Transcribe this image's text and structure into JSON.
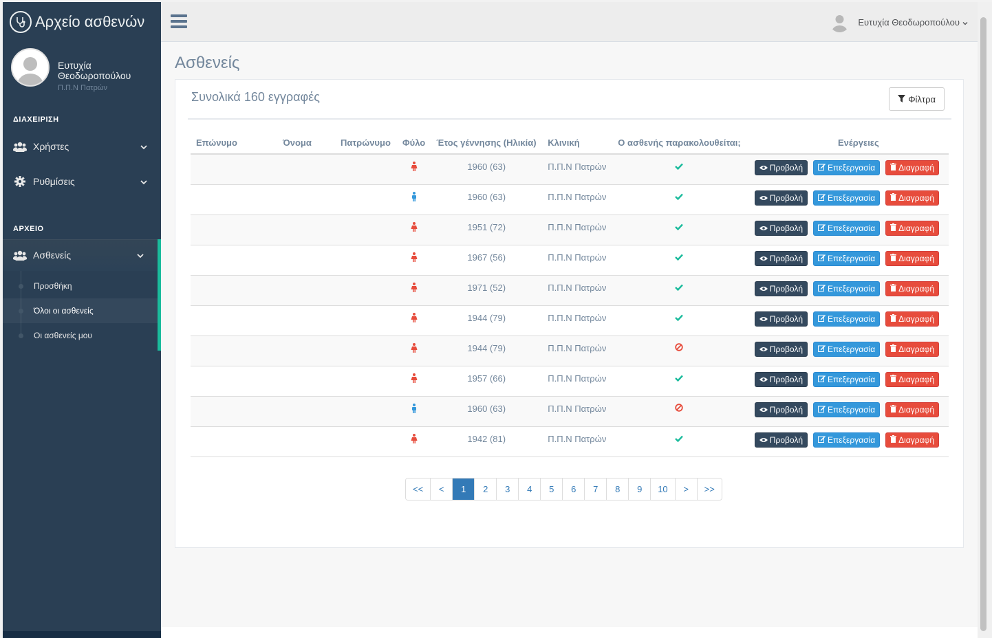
{
  "app": {
    "title": "Αρχείο ασθενών"
  },
  "profile": {
    "name": "Ευτυχία Θεοδωροπούλου",
    "clinic": "Π.Π.Ν Πατρών"
  },
  "sidebar": {
    "section_admin": "ΔΙΑΧΕΙΡΙΣΗ",
    "users": "Χρήστες",
    "settings": "Ρυθμίσεις",
    "section_archive": "ΑΡΧΕΙΟ",
    "patients": "Ασθενείς",
    "submenu": [
      {
        "label": "Προσθήκη"
      },
      {
        "label": "Όλοι οι ασθενείς"
      },
      {
        "label": "Οι ασθενείς μου"
      }
    ]
  },
  "topnav": {
    "user_name": "Ευτυχία Θεοδωροπούλου"
  },
  "page": {
    "title": "Ασθενείς",
    "total_label": "Συνολικά 160 εγγραφές",
    "filter_label": "Φίλτρα"
  },
  "table": {
    "headers": {
      "surname": "Επώνυμο",
      "name": "Όνομα",
      "patronymic": "Πατρώνυμο",
      "sex": "Φύλο",
      "birth": "Έτος γέννησης (Ηλικία)",
      "clinic": "Κλινική",
      "followed": "Ο ασθενής παρακολουθείται;",
      "actions": "Ενέργειες"
    },
    "actions": {
      "view": "Προβολή",
      "edit": "Επεξεργασία",
      "delete": "Διαγραφή"
    },
    "rows": [
      {
        "surname": "",
        "name": "",
        "patronymic": "",
        "sex": "female",
        "birth": "1960  (63)",
        "clinic": "Π.Π.Ν Πατρών",
        "followed": true
      },
      {
        "surname": "",
        "name": "",
        "patronymic": "",
        "sex": "male",
        "birth": "1960  (63)",
        "clinic": "Π.Π.Ν Πατρών",
        "followed": true
      },
      {
        "surname": "",
        "name": "",
        "patronymic": "",
        "sex": "female",
        "birth": "1951  (72)",
        "clinic": "Π.Π.Ν Πατρών",
        "followed": true
      },
      {
        "surname": "",
        "name": "",
        "patronymic": "",
        "sex": "female",
        "birth": "1967  (56)",
        "clinic": "Π.Π.Ν Πατρών",
        "followed": true
      },
      {
        "surname": "",
        "name": "",
        "patronymic": "",
        "sex": "female",
        "birth": "1971  (52)",
        "clinic": "Π.Π.Ν Πατρών",
        "followed": true
      },
      {
        "surname": "",
        "name": "",
        "patronymic": "",
        "sex": "female",
        "birth": "1944  (79)",
        "clinic": "Π.Π.Ν Πατρών",
        "followed": true
      },
      {
        "surname": "",
        "name": "",
        "patronymic": "",
        "sex": "female",
        "birth": "1944  (79)",
        "clinic": "Π.Π.Ν Πατρών",
        "followed": false
      },
      {
        "surname": "",
        "name": "",
        "patronymic": "",
        "sex": "female",
        "birth": "1957  (66)",
        "clinic": "Π.Π.Ν Πατρών",
        "followed": true
      },
      {
        "surname": "",
        "name": "",
        "patronymic": "",
        "sex": "male",
        "birth": "1960  (63)",
        "clinic": "Π.Π.Ν Πατρών",
        "followed": false
      },
      {
        "surname": "",
        "name": "",
        "patronymic": "",
        "sex": "female",
        "birth": "1942  (81)",
        "clinic": "Π.Π.Ν Πατρών",
        "followed": true
      }
    ]
  },
  "pagination": {
    "items": [
      "<<",
      "<",
      "1",
      "2",
      "3",
      "4",
      "5",
      "6",
      "7",
      "8",
      "9",
      "10",
      ">",
      ">>"
    ],
    "active": "1"
  },
  "colors": {
    "sidebar": "#2a3f54",
    "accent": "#1abb9c",
    "female": "#e74c3c",
    "male": "#3498db",
    "check": "#1abb9c",
    "ban": "#e74c3c"
  }
}
